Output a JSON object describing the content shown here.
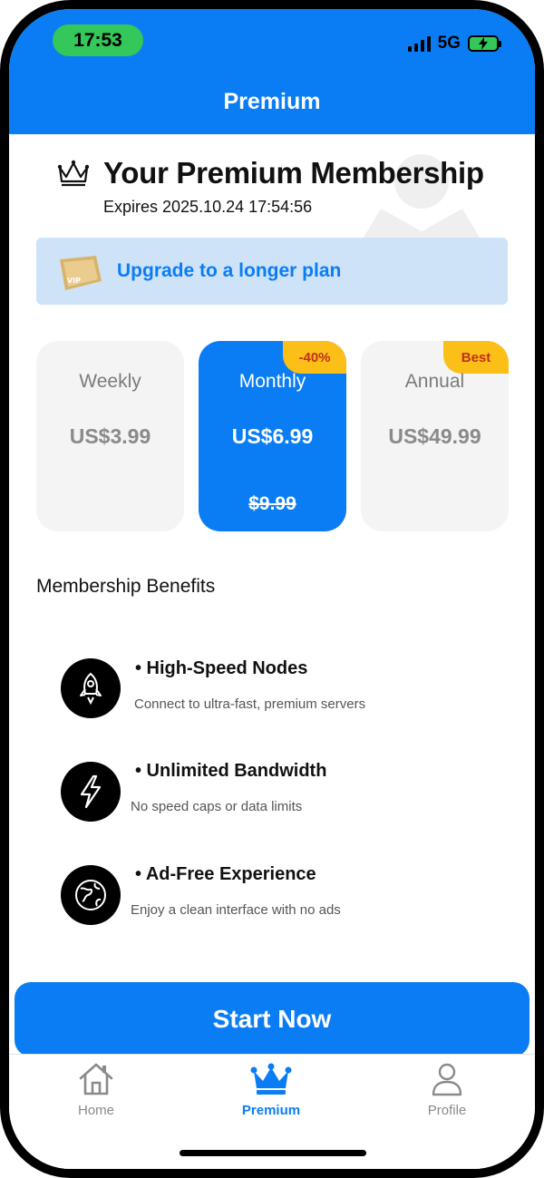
{
  "status_bar": {
    "time": "17:53",
    "network": "5G"
  },
  "header": {
    "title": "Premium"
  },
  "membership": {
    "title": "Your Premium Membership",
    "expiry": "Expires 2025.10.24 17:54:56"
  },
  "upgrade_banner": {
    "icon": "vip-ticket-icon",
    "text": "Upgrade to a longer plan"
  },
  "plans": [
    {
      "name": "Weekly",
      "price": "US$3.99",
      "badge": "",
      "original_price": "",
      "selected": false
    },
    {
      "name": "Monthly",
      "price": "US$6.99",
      "badge": "-40%",
      "original_price": "$9.99",
      "selected": true
    },
    {
      "name": "Annual",
      "price": "US$49.99",
      "badge": "Best",
      "original_price": "",
      "selected": false
    }
  ],
  "benefits": {
    "heading": "Membership Benefits",
    "items": [
      {
        "icon": "rocket-icon",
        "title": "• High-Speed Nodes",
        "description": "Connect to ultra-fast, premium servers"
      },
      {
        "icon": "lightning-icon",
        "title": "• Unlimited Bandwidth",
        "description": "No speed caps or data limits"
      },
      {
        "icon": "globe-icon",
        "title": "• Ad-Free Experience",
        "description": "Enjoy a clean interface with no ads"
      }
    ]
  },
  "cta": {
    "label": "Start Now"
  },
  "tabbar": {
    "items": [
      {
        "label": "Home",
        "icon": "home-icon",
        "active": false
      },
      {
        "label": "Premium",
        "icon": "crown-icon",
        "active": true
      },
      {
        "label": "Profile",
        "icon": "person-icon",
        "active": false
      }
    ]
  },
  "colors": {
    "accent": "#0a7df5",
    "badge": "#fbbf17",
    "banner": "#cfe3f8",
    "status_time_pill": "#34c759"
  }
}
